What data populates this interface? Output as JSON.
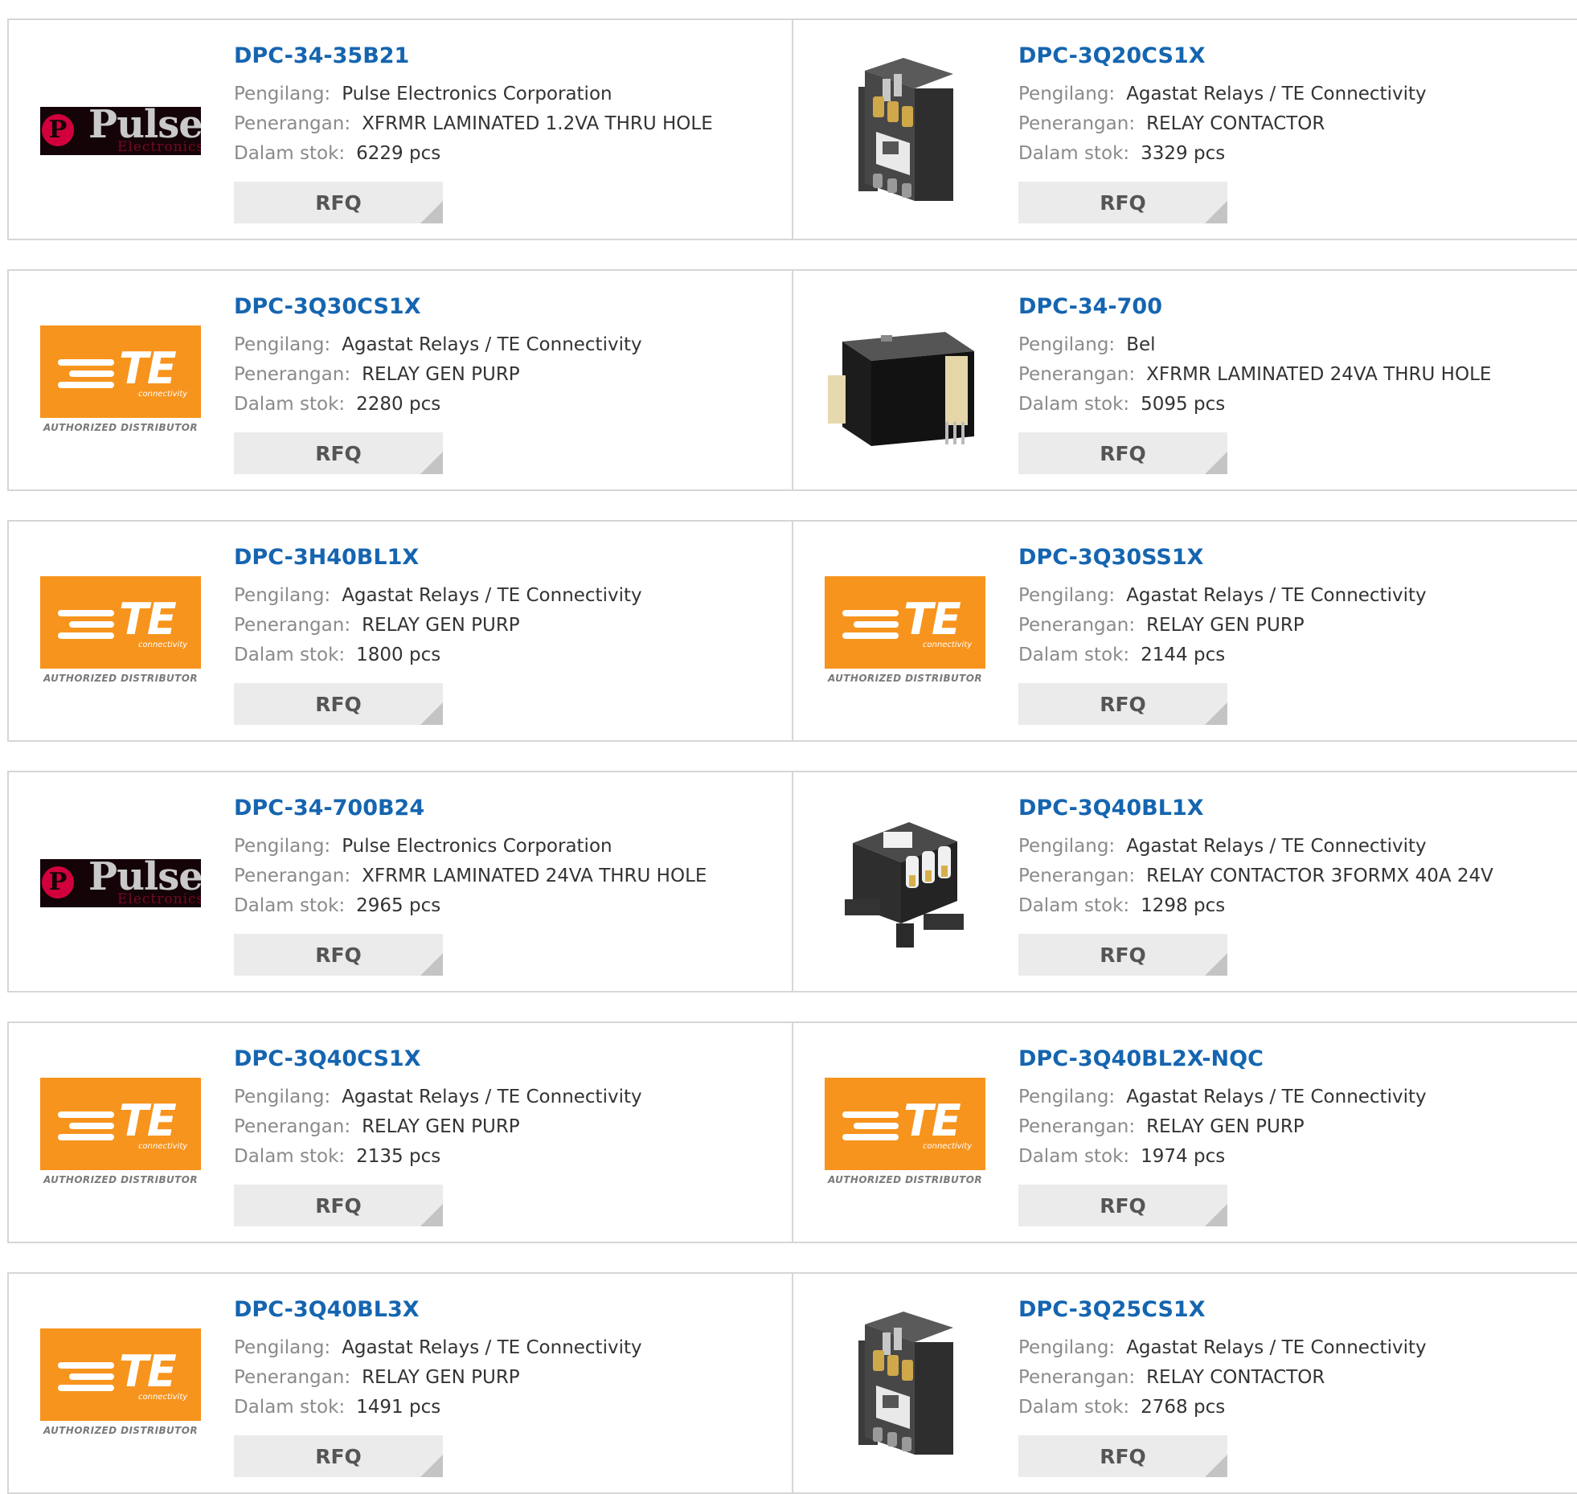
{
  "labels": {
    "manufacturer": "Pengilang:",
    "description": "Penerangan:",
    "stock": "Dalam stok:",
    "rfq": "RFQ"
  },
  "logos": {
    "pulse": {
      "word": "Pulse",
      "sub": "Electronics",
      "mark": "P"
    },
    "te": {
      "word": "TE",
      "sub": "connectivity",
      "authorized": "AUTHORIZED DISTRIBUTOR"
    }
  },
  "colors": {
    "part_link": "#1565b0",
    "te_orange": "#f7941d",
    "rfq_bg": "#ebebeb",
    "border": "#d6d6d6"
  },
  "products": [
    {
      "part": "DPC-34-35B21",
      "manufacturer": "Pulse Electronics Corporation",
      "description": "XFRMR LAMINATED 1.2VA THRU HOLE",
      "stock": "6229 pcs",
      "image": "pulse-logo"
    },
    {
      "part": "DPC-3Q20CS1X",
      "manufacturer": "Agastat Relays / TE Connectivity",
      "description": "RELAY CONTACTOR",
      "stock": "3329 pcs",
      "image": "contactor-photo"
    },
    {
      "part": "DPC-3Q30CS1X",
      "manufacturer": "Agastat Relays / TE Connectivity",
      "description": "RELAY GEN PURP",
      "stock": "2280 pcs",
      "image": "te-logo"
    },
    {
      "part": "DPC-34-700",
      "manufacturer": "Bel",
      "description": "XFRMR LAMINATED 24VA THRU HOLE",
      "stock": "5095 pcs",
      "image": "transformer-photo"
    },
    {
      "part": "DPC-3H40BL1X",
      "manufacturer": "Agastat Relays / TE Connectivity",
      "description": "RELAY GEN PURP",
      "stock": "1800 pcs",
      "image": "te-logo"
    },
    {
      "part": "DPC-3Q30SS1X",
      "manufacturer": "Agastat Relays / TE Connectivity",
      "description": "RELAY GEN PURP",
      "stock": "2144 pcs",
      "image": "te-logo"
    },
    {
      "part": "DPC-34-700B24",
      "manufacturer": "Pulse Electronics Corporation",
      "description": "XFRMR LAMINATED 24VA THRU HOLE",
      "stock": "2965 pcs",
      "image": "pulse-logo"
    },
    {
      "part": "DPC-3Q40BL1X",
      "manufacturer": "Agastat Relays / TE Connectivity",
      "description": "RELAY CONTACTOR 3FORMX 40A 24V",
      "stock": "1298 pcs",
      "image": "contactor-photo-3pole"
    },
    {
      "part": "DPC-3Q40CS1X",
      "manufacturer": "Agastat Relays / TE Connectivity",
      "description": "RELAY GEN PURP",
      "stock": "2135 pcs",
      "image": "te-logo"
    },
    {
      "part": "DPC-3Q40BL2X-NQC",
      "manufacturer": "Agastat Relays / TE Connectivity",
      "description": "RELAY GEN PURP",
      "stock": "1974 pcs",
      "image": "te-logo"
    },
    {
      "part": "DPC-3Q40BL3X",
      "manufacturer": "Agastat Relays / TE Connectivity",
      "description": "RELAY GEN PURP",
      "stock": "1491 pcs",
      "image": "te-logo"
    },
    {
      "part": "DPC-3Q25CS1X",
      "manufacturer": "Agastat Relays / TE Connectivity",
      "description": "RELAY CONTACTOR",
      "stock": "2768 pcs",
      "image": "contactor-photo"
    }
  ]
}
